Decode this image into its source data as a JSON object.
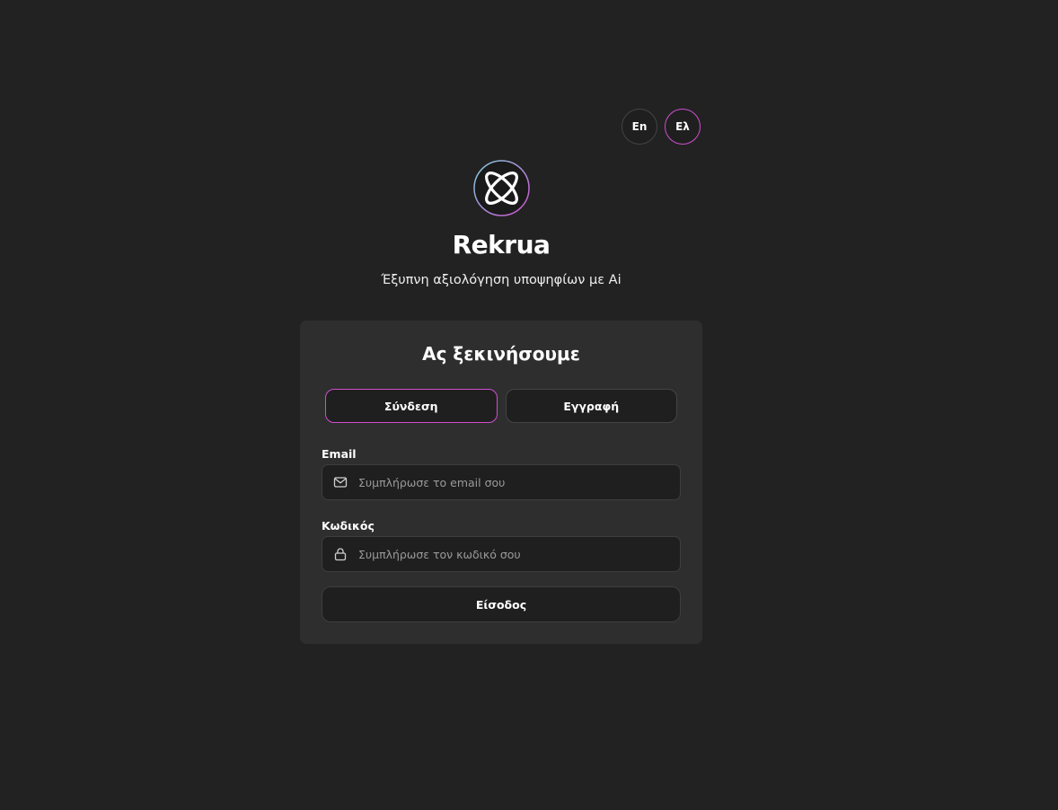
{
  "language_switch": {
    "options": [
      {
        "label": "En",
        "active": false
      },
      {
        "label": "Ελ",
        "active": true
      }
    ]
  },
  "brand": {
    "logo_icon": "orbit-logo-icon",
    "name": "Rekrua",
    "tagline": "Έξυπνη αξιολόγηση υποψηφίων με Ai"
  },
  "auth_card": {
    "title": "Ας ξεκινήσουμε",
    "tabs": [
      {
        "label": "Σύνδεση",
        "active": true
      },
      {
        "label": "Εγγραφή",
        "active": false
      }
    ],
    "email": {
      "label": "Email",
      "value": "",
      "placeholder": "Συμπλήρωσε το email σου",
      "icon": "mail-icon"
    },
    "password": {
      "label": "Κωδικός",
      "value": "",
      "placeholder": "Συμπλήρωσε τον κωδικό σου",
      "icon": "lock-icon"
    },
    "submit_label": "Είσοδος"
  },
  "colors": {
    "background": "#222222",
    "card": "#2e2e2e",
    "accent": "#d04fd0"
  }
}
